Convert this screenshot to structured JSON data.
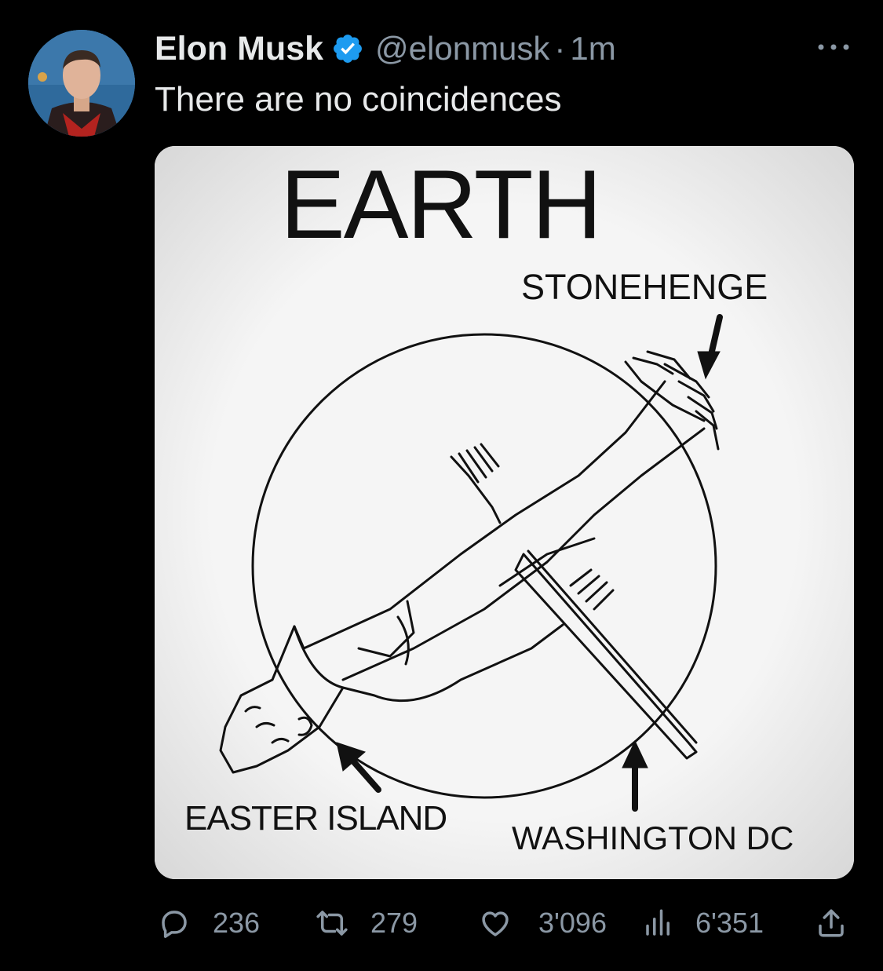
{
  "tweet": {
    "author_name": "Elon Musk",
    "handle": "@elonmusk",
    "separator": "·",
    "time": "1m",
    "text": "There are no coincidences"
  },
  "media": {
    "title": "EARTH",
    "labels": {
      "stonehenge": "STONEHENGE",
      "easter_island": "EASTER ISLAND",
      "washington": "WASHINGTON DC"
    }
  },
  "actions": {
    "replies": "236",
    "retweets": "279",
    "likes": "3'096",
    "views": "6'351"
  },
  "icons": {
    "verified": "verified-badge-icon",
    "more": "more-icon",
    "reply": "reply-icon",
    "retweet": "retweet-icon",
    "like": "heart-icon",
    "views": "views-icon",
    "share": "share-icon"
  },
  "colors": {
    "background": "#000000",
    "text": "#e7e9ea",
    "muted": "#8b98a5",
    "verified": "#1d9bf0"
  }
}
